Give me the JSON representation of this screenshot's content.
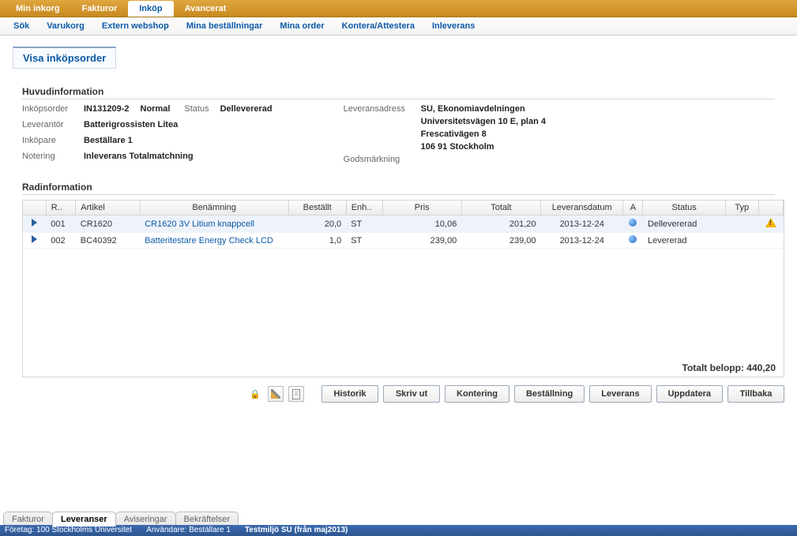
{
  "topTabs": [
    "Min inkorg",
    "Fakturor",
    "Inköp",
    "Avancerat"
  ],
  "topTabActive": 2,
  "subTabs": [
    "Sök",
    "Varukorg",
    "Extern webshop",
    "Mina beställningar",
    "Mina order",
    "Kontera/Attestera",
    "Inleverans"
  ],
  "subTabActive": 4,
  "pageTitle": "Visa inköpsorder",
  "sections": {
    "main": "Huvudinformation",
    "lines": "Radinformation"
  },
  "info": {
    "labels": {
      "order": "Inköpsorder",
      "supplier": "Leverantör",
      "buyer": "Inköpare",
      "note": "Notering",
      "status": "Status",
      "delivAddr": "Leveransadress",
      "goodsMark": "Godsmärkning"
    },
    "order": "IN131209-2",
    "priority": "Normal",
    "status": "Dellevererad",
    "supplier": "Batterigrossisten Litea",
    "buyer": "Beställare 1",
    "note": "Inleverans Totalmatchning",
    "delivAddr": [
      "SU, Ekonomiavdelningen",
      "Universitetsvägen 10 E, plan 4",
      "Frescativägen 8",
      "106 91 Stockholm"
    ],
    "goodsMark": ""
  },
  "table": {
    "headers": [
      "",
      "R..",
      "Artikel",
      "Benämning",
      "Beställt",
      "Enh..",
      "Pris",
      "Totalt",
      "Leveransdatum",
      "A",
      "Status",
      "Typ",
      ""
    ],
    "rows": [
      {
        "r": "001",
        "artikel": "CR1620",
        "benamning": "CR1620 3V Litium knappcell",
        "bestallt": "20,0",
        "enh": "ST",
        "pris": "10,06",
        "totalt": "201,20",
        "lev": "2013-12-24",
        "status": "Dellevererad",
        "warn": true,
        "sel": true
      },
      {
        "r": "002",
        "artikel": "BC40392",
        "benamning": "Batteritestare Energy Check LCD",
        "bestallt": "1,0",
        "enh": "ST",
        "pris": "239,00",
        "totalt": "239,00",
        "lev": "2013-12-24",
        "status": "Levererad",
        "warn": false,
        "sel": false
      }
    ],
    "totalLabel": "Totalt belopp:",
    "totalValue": "440,20"
  },
  "buttons": [
    "Historik",
    "Skriv ut",
    "Kontering",
    "Beställning",
    "Leverans",
    "Uppdatera",
    "Tillbaka"
  ],
  "bottomTabs": [
    "Fakturor",
    "Leveranser",
    "Aviseringar",
    "Bekräftelser"
  ],
  "bottomTabActive": 1,
  "statusBar": {
    "company": "Företag: 100 Stockholms Universitet",
    "user": "Användare: Beställare 1",
    "env": "Testmiljö SU (från maj2013)"
  }
}
